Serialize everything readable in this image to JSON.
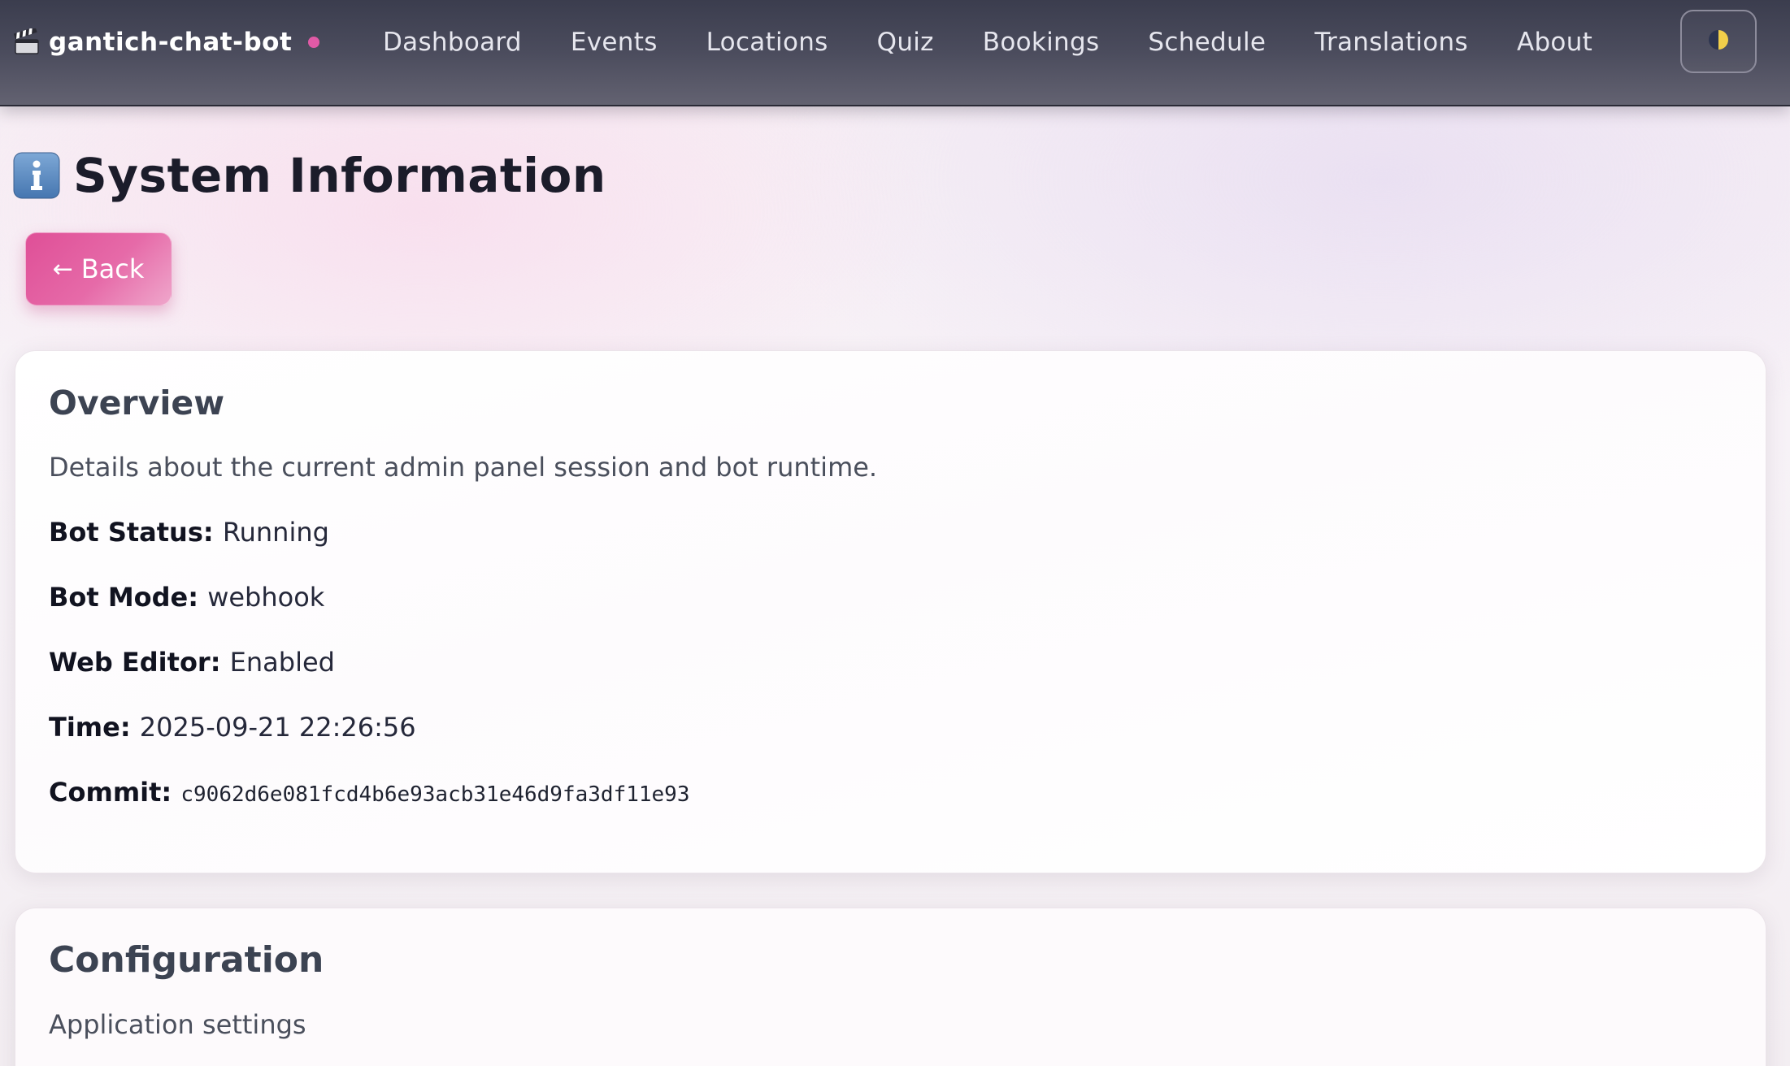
{
  "navbar": {
    "brand": "gantich-chat-bot",
    "links": [
      "Dashboard",
      "Events",
      "Locations",
      "Quiz",
      "Bookings",
      "Schedule",
      "Translations",
      "About"
    ],
    "accent_dot_color": "#e05aa6"
  },
  "page": {
    "title": "System Information",
    "title_icon": "info-icon",
    "back_label": "Back",
    "back_color": "#df4f97"
  },
  "overview": {
    "title": "Overview",
    "description": "Details about the current admin panel session and bot runtime.",
    "rows": [
      {
        "label": "Bot Status:",
        "value": "Running"
      },
      {
        "label": "Bot Mode:",
        "value": "webhook"
      },
      {
        "label": "Web Editor:",
        "value": "Enabled"
      },
      {
        "label": "Time:",
        "value": "2025-09-21 22:26:56"
      },
      {
        "label": "Commit:",
        "value": "c9062d6e081fcd4b6e93acb31e46d9fa3df11e93"
      }
    ]
  },
  "configuration": {
    "title": "Configuration",
    "description": "Application settings"
  }
}
